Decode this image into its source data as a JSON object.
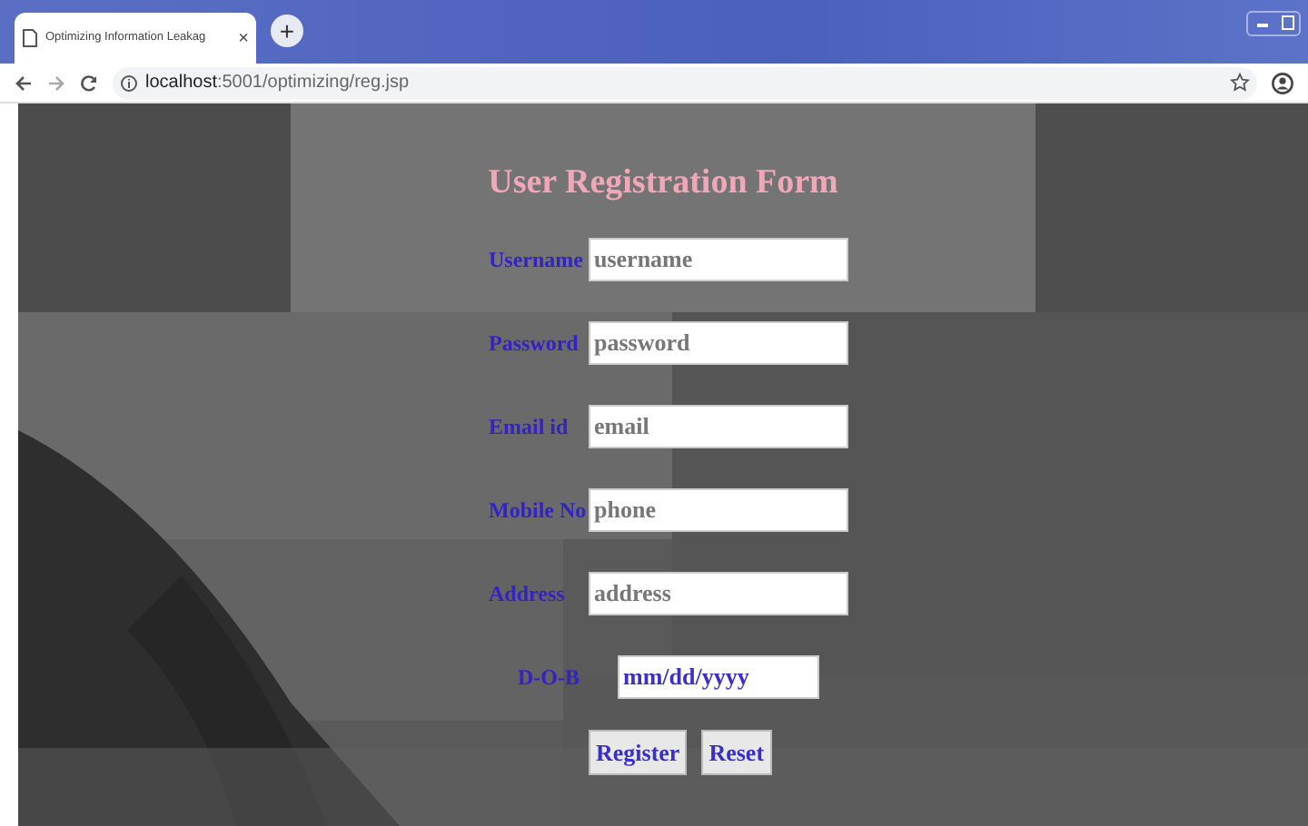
{
  "browser": {
    "tab_title": "Optimizing Information Leakag",
    "tab_close": "×",
    "new_tab": "+",
    "url_host": "localhost",
    "url_path": ":5001/optimizing/reg.jsp"
  },
  "form": {
    "title": "User Registration Form",
    "fields": [
      {
        "label": "Username",
        "placeholder": "username",
        "kind": "text"
      },
      {
        "label": "Password",
        "placeholder": "password",
        "kind": "text"
      },
      {
        "label": "Email id",
        "placeholder": "email",
        "kind": "text"
      },
      {
        "label": "Mobile No",
        "placeholder": "phone",
        "kind": "text"
      },
      {
        "label": "Address",
        "placeholder": "address",
        "kind": "text"
      },
      {
        "label": "D-O-B",
        "placeholder": "mm/dd/yyyy",
        "kind": "date"
      }
    ],
    "buttons": [
      "Register",
      "Reset"
    ]
  }
}
